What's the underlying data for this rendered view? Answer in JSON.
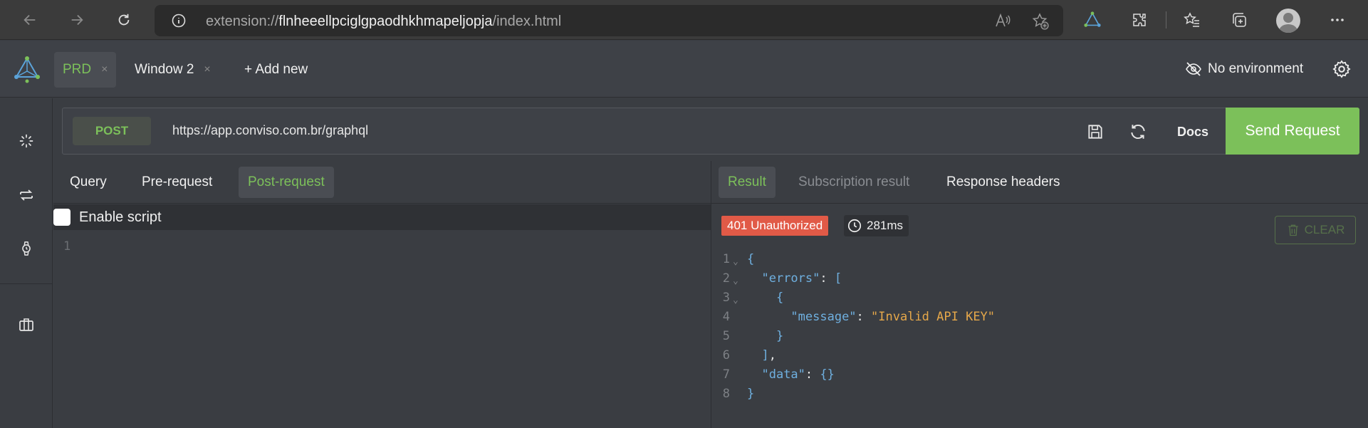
{
  "browser": {
    "url_scheme": "extension://",
    "url_host": "flnheeellpciglgpaodhkhmapeljopja",
    "url_path": "/index.html"
  },
  "app": {
    "tabs": [
      {
        "label": "PRD",
        "close": "×",
        "active": true
      },
      {
        "label": "Window 2",
        "close": "×",
        "active": false
      }
    ],
    "add_new": "+ Add new",
    "environment": "No environment"
  },
  "request": {
    "method": "POST",
    "url": "https://app.conviso.com.br/graphql",
    "docs_label": "Docs",
    "send_label": "Send Request"
  },
  "left_pane": {
    "tabs": [
      "Query",
      "Pre-request",
      "Post-request"
    ],
    "active_tab": "Post-request",
    "enable_script_label": "Enable script",
    "editor_line": "1"
  },
  "right_pane": {
    "tabs": [
      "Result",
      "Subscription result",
      "Response headers"
    ],
    "active_tab": "Result",
    "status": "401 Unauthorized",
    "time": "281ms",
    "clear_label": "CLEAR",
    "response_lines": [
      {
        "n": "1",
        "fold": true
      },
      {
        "n": "2",
        "fold": true
      },
      {
        "n": "3",
        "fold": true
      },
      {
        "n": "4",
        "fold": false
      },
      {
        "n": "5",
        "fold": false
      },
      {
        "n": "6",
        "fold": false
      },
      {
        "n": "7",
        "fold": false
      },
      {
        "n": "8",
        "fold": false
      }
    ],
    "json": {
      "key_errors": "\"errors\"",
      "key_message": "\"message\"",
      "val_message": "\"Invalid API KEY\"",
      "key_data": "\"data\"",
      "val_data": "{}"
    }
  },
  "colors": {
    "accent": "#7cc05a",
    "error": "#e15a47"
  }
}
